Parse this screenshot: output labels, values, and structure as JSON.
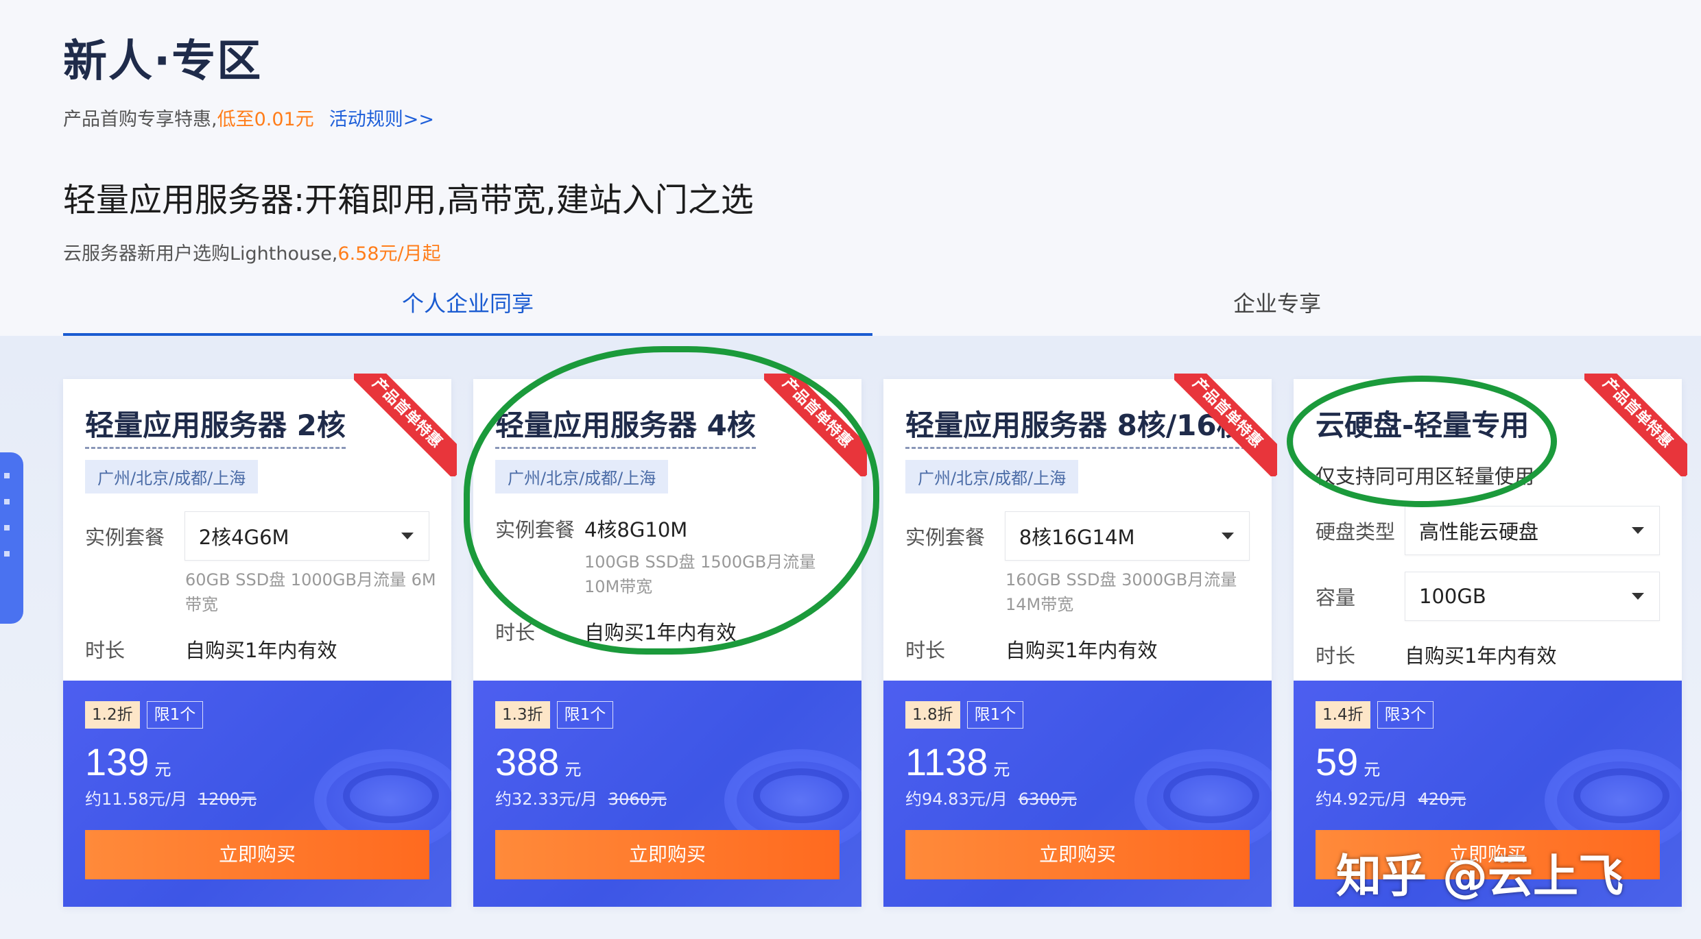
{
  "header": {
    "title": "新人·专区",
    "promo_text": "产品首购专享特惠,",
    "promo_highlight": "低至0.01元",
    "rules_link": "活动规则>>"
  },
  "section": {
    "title": "轻量应用服务器:开箱即用,高带宽,建站入门之选",
    "subtitle": "云服务器新用户选购Lighthouse,",
    "subtitle_highlight": "6.58元/月起"
  },
  "tabs": [
    {
      "label": "个人企业同享",
      "active": true
    },
    {
      "label": "企业专享",
      "active": false
    }
  ],
  "ribbon_text": "产品首单特惠",
  "buy_label": "立即购买",
  "cards": [
    {
      "title": "轻量应用服务器 2核",
      "region": "广州/北京/成都/上海",
      "plan_label": "实例套餐",
      "plan_value": "2核4G6M",
      "spec": "60GB SSD盘 1000GB月流量 6M带宽",
      "duration_label": "时长",
      "duration_value": "自购买1年内有效",
      "discount": "1.2折",
      "limit": "限1个",
      "price": "139",
      "price_unit": "元",
      "per_month": "约11.58元/月",
      "original": "1200元"
    },
    {
      "title": "轻量应用服务器 4核",
      "region": "广州/北京/成都/上海",
      "plan_label": "实例套餐",
      "plan_value": "4核8G10M",
      "spec": "100GB SSD盘 1500GB月流量 10M带宽",
      "duration_label": "时长",
      "duration_value": "自购买1年内有效",
      "discount": "1.3折",
      "limit": "限1个",
      "price": "388",
      "price_unit": "元",
      "per_month": "约32.33元/月",
      "original": "3060元"
    },
    {
      "title": "轻量应用服务器 8核/16核",
      "region": "广州/北京/成都/上海",
      "plan_label": "实例套餐",
      "plan_value": "8核16G14M",
      "spec": "160GB SSD盘 3000GB月流量 14M带宽",
      "duration_label": "时长",
      "duration_value": "自购买1年内有效",
      "discount": "1.8折",
      "limit": "限1个",
      "price": "1138",
      "price_unit": "元",
      "per_month": "约94.83元/月",
      "original": "6300元"
    },
    {
      "title": "云硬盘-轻量专用",
      "note": "仅支持同可用区轻量使用",
      "disk_type_label": "硬盘类型",
      "disk_type_value": "高性能云硬盘",
      "capacity_label": "容量",
      "capacity_value": "100GB",
      "duration_label": "时长",
      "duration_value": "自购买1年内有效",
      "discount": "1.4折",
      "limit": "限3个",
      "price": "59",
      "price_unit": "元",
      "per_month": "约4.92元/月",
      "original": "420元"
    }
  ],
  "watermark": "知乎 @云上飞",
  "colors": {
    "accent_blue": "#1a5bd1",
    "price_panel": "#4559ec",
    "buy_orange": "#ff7a2a",
    "highlight_orange": "#ff7d1a",
    "ribbon_red": "#e8353b",
    "annotation_green": "#1b9a3b"
  }
}
